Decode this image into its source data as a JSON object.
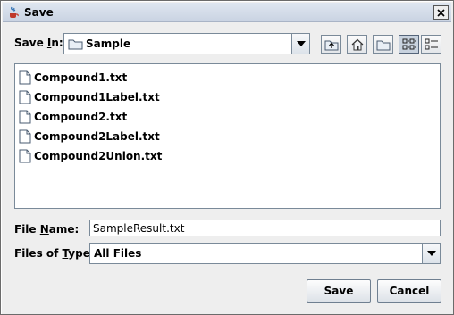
{
  "window": {
    "title": "Save"
  },
  "save_in": {
    "label_before": "Save ",
    "label_mnemonic": "I",
    "label_after": "n:",
    "value": "Sample"
  },
  "toolbar": {
    "buttons": [
      "up-one-level-icon",
      "home-icon",
      "new-folder-icon",
      "list-view-icon",
      "details-view-icon"
    ],
    "active": "list-view-icon"
  },
  "files": [
    "Compound1.txt",
    "Compound1Label.txt",
    "Compound2.txt",
    "Compound2Label.txt",
    "Compound2Union.txt"
  ],
  "file_name": {
    "label_before": "File ",
    "label_mnemonic": "N",
    "label_after": "ame:",
    "value": "SampleResult.txt"
  },
  "file_type": {
    "label_before": "Files of ",
    "label_mnemonic": "T",
    "label_after": "ype:",
    "value": "All Files"
  },
  "buttons": {
    "save": "Save",
    "cancel": "Cancel"
  }
}
